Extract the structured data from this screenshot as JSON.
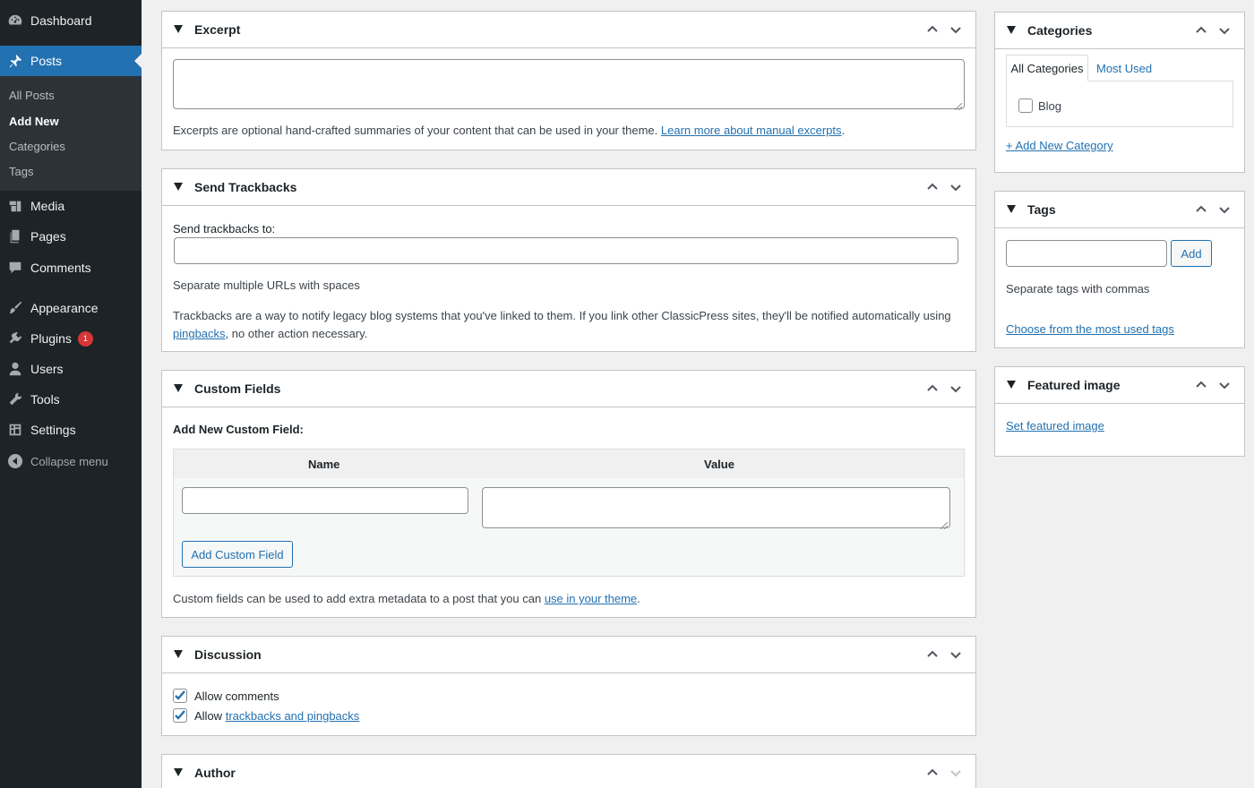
{
  "sidebar": {
    "dashboard": "Dashboard",
    "posts": "Posts",
    "submenu": [
      "All Posts",
      "Add New",
      "Categories",
      "Tags"
    ],
    "media": "Media",
    "pages": "Pages",
    "comments": "Comments",
    "appearance": "Appearance",
    "plugins": "Plugins",
    "plugins_badge": "1",
    "users": "Users",
    "tools": "Tools",
    "settings": "Settings",
    "collapse": "Collapse menu"
  },
  "excerpt": {
    "title": "Excerpt",
    "value": "",
    "help_text": "Excerpts are optional hand-crafted summaries of your content that can be used in your theme.",
    "link_text": "Learn more about manual excerpts",
    "trailing": "."
  },
  "trackbacks": {
    "title": "Send Trackbacks",
    "label": "Send trackbacks to:",
    "value": "",
    "hint": "Separate multiple URLs with spaces",
    "desc_1": "Trackbacks are a way to notify legacy blog systems that you've linked to them. If you link other ClassicPress sites, they'll be notified automatically using",
    "link_text": "pingbacks",
    "desc_2": ", no other action necessary."
  },
  "custom_fields": {
    "title": "Custom Fields",
    "add_label": "Add New Custom Field:",
    "col_name": "Name",
    "col_value": "Value",
    "name_value": "",
    "value_value": "",
    "button": "Add Custom Field",
    "help_text": "Custom fields can be used to add extra metadata to a post that you can",
    "link_text": "use in your theme",
    "trailing": "."
  },
  "discussion": {
    "title": "Discussion",
    "allow_comments": "Allow comments",
    "allow_comments_checked": true,
    "allow_prefix": "Allow",
    "trackbacks_link": "trackbacks and pingbacks",
    "allow_trackbacks_checked": true
  },
  "author": {
    "title": "Author"
  },
  "categories": {
    "title": "Categories",
    "tab_all": "All Categories",
    "tab_most_used": "Most Used",
    "items": [
      {
        "label": "Blog",
        "checked": false
      }
    ],
    "add_new": "+ Add New Category"
  },
  "tags": {
    "title": "Tags",
    "value": "",
    "add_button": "Add",
    "hint": "Separate tags with commas",
    "choose_link": "Choose from the most used tags"
  },
  "featured_image": {
    "title": "Featured image",
    "link": "Set featured image"
  },
  "colors": {
    "sidebar_bg": "#1d2327",
    "accent": "#2271b1",
    "badge": "#d63638"
  }
}
